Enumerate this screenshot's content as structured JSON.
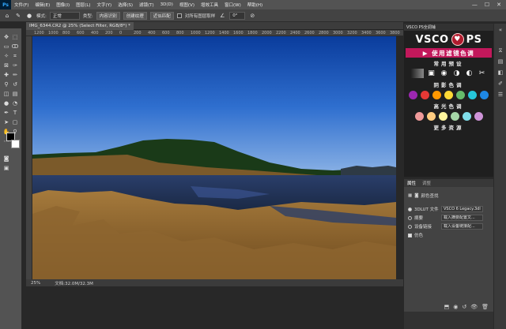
{
  "app": {
    "logo": "Ps"
  },
  "menu": [
    "文件(F)",
    "编辑(E)",
    "图像(I)",
    "图层(L)",
    "文字(Y)",
    "选择(S)",
    "滤镜(T)",
    "3D(D)",
    "视图(V)",
    "增效工具",
    "窗口(W)",
    "帮助(H)"
  ],
  "window_controls": {
    "min": "—",
    "max": "☐",
    "close": "✕"
  },
  "options": {
    "mode_label": "模式:",
    "mode_value": "正常",
    "type_label": "类型:",
    "content_aware": "内容识别",
    "create_texture": "创建纹理",
    "proximity_match": "近似匹配",
    "sample_all": "对所有图层取样",
    "angle": "0°"
  },
  "document": {
    "tab_title": "IMG_6344.CR2 @ 25% (Select Filter, RGB/8*) *",
    "zoom": "25%",
    "doc_size": "文档:32.0M/32.3M"
  },
  "ruler": [
    "1200",
    "1000",
    "800",
    "600",
    "400",
    "200",
    "0",
    "200",
    "400",
    "600",
    "800",
    "1000",
    "1200",
    "1400",
    "1600",
    "1800",
    "2000",
    "2200",
    "2400",
    "2600",
    "2800",
    "3000",
    "3200",
    "3400",
    "3600",
    "3800"
  ],
  "vsco": {
    "tab_title": "VSCO PS全调铺",
    "brand_left": "VSCO",
    "brand_seal": "♥",
    "brand_right": "PS",
    "cta": "▶ 使用滤镜色调",
    "common_presets": "常用预设",
    "shadow_color": "阴影色调",
    "highlight_color": "高光色调",
    "more_resources": "更多资源",
    "shadow_dots": [
      "#9c27b0",
      "#e53935",
      "#ff9800",
      "#fdd835",
      "#66bb6a",
      "#26c6da",
      "#1e88e5"
    ],
    "highlight_dots": [
      "#ef9a9a",
      "#ffcc80",
      "#fff59d",
      "#a5d6a7",
      "#80deea",
      "#ce93d8"
    ]
  },
  "properties": {
    "tab_properties": "属性",
    "tab_adjust": "调整",
    "section": "颜色查找",
    "lut3d_label": "3DLUT 文件",
    "lut3d_value": "VSCO 6 Legacy.3dl",
    "abstract_label": "摘要",
    "abstract_value": "载入摘要配置文...",
    "device_link_label": "设备链接",
    "device_link_value": "载入设备链接配...",
    "dither_label": "仿色"
  }
}
